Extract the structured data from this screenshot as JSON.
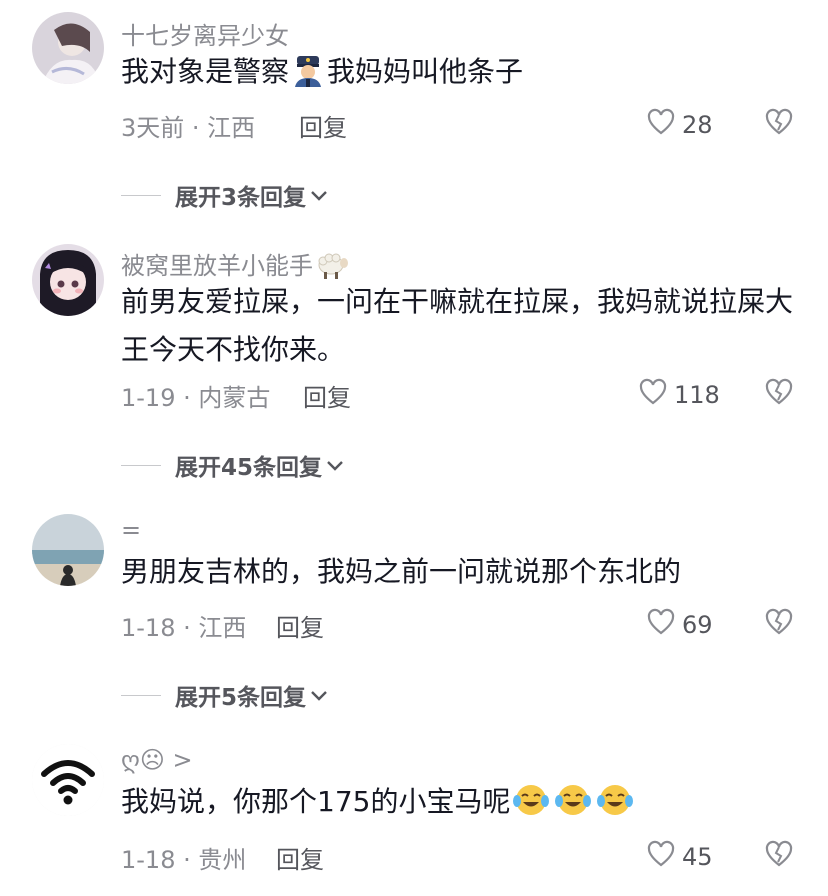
{
  "comments": [
    {
      "username": "十七岁离异少女",
      "text_before": "我对象是警察",
      "emoji": "police-officer",
      "text_after": "我妈妈叫他条子",
      "meta": "3天前 · 江西",
      "reply": "回复",
      "likes": "28",
      "expand": "展开3条回复"
    },
    {
      "username": "被窝里放羊小能手",
      "username_emoji": "sheep",
      "text": "前男友爱拉屎，一问在干嘛就在拉屎，我妈就说拉屎大王今天不找你来。",
      "meta": "1-19 · 内蒙古",
      "reply": "回复",
      "likes": "118",
      "expand": "展开45条回复"
    },
    {
      "username": "=",
      "text": "男朋友吉林的，我妈之前一问就说那个东北的",
      "meta": "1-18 · 江西",
      "reply": "回复",
      "likes": "69",
      "expand": "展开5条回复"
    },
    {
      "username": "ღ☹ >",
      "text": "我妈说，你那个175的小宝马呢",
      "emojis": [
        "crying-laughing",
        "crying-laughing",
        "crying-laughing"
      ],
      "meta": "1-18 · 贵州",
      "reply": "回复",
      "likes": "45"
    }
  ]
}
